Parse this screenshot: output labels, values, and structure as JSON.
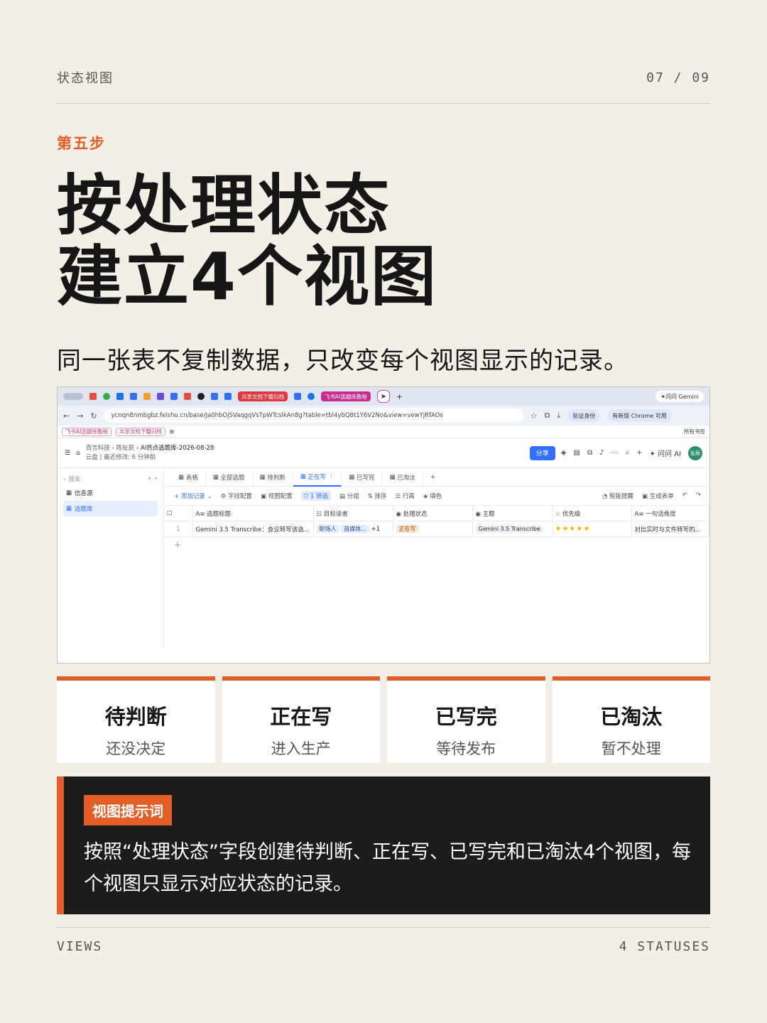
{
  "header": {
    "section": "状态视图",
    "page": "07 / 09"
  },
  "step_label": "第五步",
  "headline": {
    "line1": "按处理状态",
    "line2": "建立4个视图"
  },
  "lead": "同一张表不复制数据，只改变每个视图显示的记录。",
  "screenshot": {
    "tab_pills": {
      "share": "共享文档下载归档",
      "tutorial": "飞书AI选题库教程"
    },
    "gemini": "问问 Gemini",
    "url": "ycnqn8nmbgbz.feishu.cn/base/Ja0hbOjSVaqgqVsTpWTcslkAn8g?table=tbl4ybQ8t1Y6V2No&view=vewYjRfAOs",
    "verify": "验证身份",
    "update": "有新版 Chrome 可用",
    "bookmarks": [
      "飞书AI选题库教程",
      "共享文档下载归档"
    ],
    "bookmarks_right": "所有书签",
    "breadcrumb": {
      "org": "百言科技",
      "user": "陈祉辰",
      "doc": "AI热点选题库-2026-08-28",
      "meta_drive": "云盘",
      "meta_edit": "最近修改: 6 分钟前"
    },
    "share": "分享",
    "ask_ai": "问问 AI",
    "avatar": "祉辰",
    "sidebar": {
      "search": "搜索",
      "items": [
        "信息源",
        "选题库"
      ]
    },
    "view_tabs": [
      "表格",
      "全部选题",
      "待判断",
      "正在写",
      "已写完",
      "已淘汰"
    ],
    "toolbar": {
      "add": "添加记录",
      "fields": "字段配置",
      "view_cfg": "视图配置",
      "filter": "1 筛选",
      "group": "分组",
      "sort": "排序",
      "row_h": "行高",
      "fill": "填色",
      "smart": "智能提醒",
      "form": "生成表单"
    },
    "columns": [
      "选题标题",
      "目标读者",
      "处理状态",
      "主题",
      "优先级",
      "一句话角度"
    ],
    "rows": [
      {
        "num": "1",
        "title": "Gemini 3.5 Transcribe：会议转写该选...",
        "reader1": "职场人",
        "reader2": "自媒体...",
        "reader_more": "+1",
        "status": "正在写",
        "topic": "Gemini 3.5 Transcribe",
        "stars": "★★★★★",
        "angle": "对比实时与文件转写的..."
      }
    ]
  },
  "cards": [
    {
      "title": "待判断",
      "sub": "还没决定"
    },
    {
      "title": "正在写",
      "sub": "进入生产"
    },
    {
      "title": "已写完",
      "sub": "等待发布"
    },
    {
      "title": "已淘汰",
      "sub": "暂不处理"
    }
  ],
  "prompt": {
    "label": "视图提示词",
    "text": "按照“处理状态”字段创建待判断、正在写、已写完和已淘汰4个视图，每个视图只显示对应状态的记录。"
  },
  "footer": {
    "left": "VIEWS",
    "right": "4 STATUSES"
  },
  "colors": {
    "accent": "#e35d26",
    "background": "#f3efe6",
    "dark": "#1c1c1c",
    "feishu_blue": "#3370ff"
  }
}
